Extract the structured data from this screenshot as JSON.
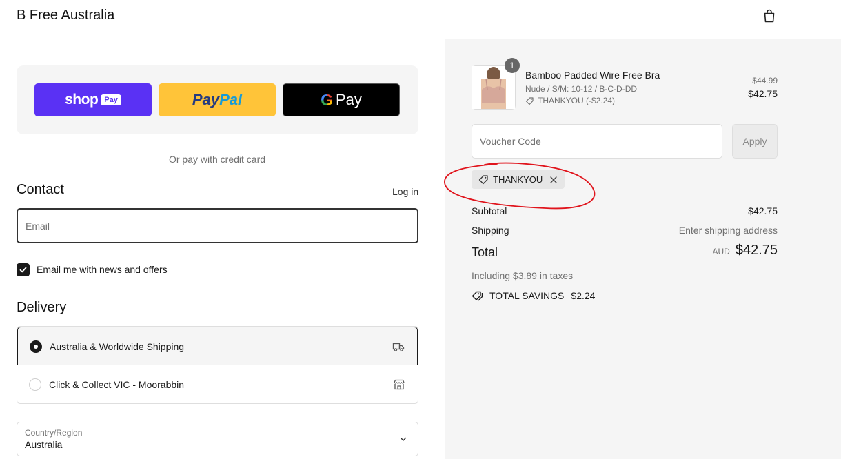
{
  "header": {
    "store_name": "B Free Australia",
    "cart_icon": "shopping-bag-icon"
  },
  "express_checkout": {
    "shop_pay": {
      "word": "shop",
      "badge": "Pay"
    },
    "paypal": {
      "part1": "Pay",
      "part2": "Pal"
    },
    "google_pay": {
      "letter": "G",
      "word": "Pay"
    },
    "or_text": "Or pay with credit card"
  },
  "contact": {
    "title": "Contact",
    "login_link": "Log in",
    "email_placeholder": "Email",
    "email_value": "",
    "newsletter_label": "Email me with news and offers",
    "newsletter_checked": true
  },
  "delivery": {
    "title": "Delivery",
    "options": [
      {
        "label": "Australia & Worldwide Shipping",
        "selected": true,
        "icon": "truck-icon"
      },
      {
        "label": "Click & Collect VIC - Moorabbin",
        "selected": false,
        "icon": "store-icon"
      }
    ],
    "country": {
      "label": "Country/Region",
      "value": "Australia"
    }
  },
  "order_summary": {
    "item": {
      "quantity": "1",
      "name": "Bamboo Padded Wire Free Bra",
      "variant": "Nude / S/M: 10-12 / B-C-D-DD",
      "discount": "THANKYOU (-$2.24)",
      "price_original": "$44.99",
      "price_final": "$42.75"
    },
    "voucher": {
      "placeholder": "Voucher Code",
      "apply_label": "Apply"
    },
    "applied_code": "THANKYOU",
    "subtotal_label": "Subtotal",
    "subtotal_value": "$42.75",
    "shipping_label": "Shipping",
    "shipping_value": "Enter shipping address",
    "total_label": "Total",
    "currency": "AUD",
    "total_value": "$42.75",
    "taxes_text": "Including $3.89 in taxes",
    "savings_label": "TOTAL SAVINGS",
    "savings_value": "$2.24"
  },
  "colors": {
    "shop_pay": "#5a31f4",
    "paypal": "#ffc439",
    "annotation": "#e0141c",
    "summary_bg": "#f5f5f5"
  }
}
